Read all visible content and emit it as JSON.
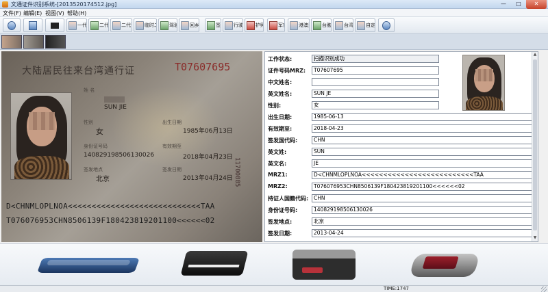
{
  "window": {
    "title": "文通证件识别系统-[2013520174512.jpg]",
    "controls": {
      "minimize": "—",
      "maximize": "□",
      "close": "✕"
    }
  },
  "menu": [
    "文件(F)",
    "编辑(E)",
    "视图(V)",
    "帮助(H)"
  ],
  "toolbar": {
    "items": [
      {
        "label": "",
        "icon": "gear-icon"
      },
      {
        "label": "",
        "icon": "camera-icon"
      },
      {
        "label": "",
        "icon": "scanner-icon"
      },
      {
        "label": "一代证",
        "icon": "id-card-icon"
      },
      {
        "label": "二代证",
        "icon": "id-card-icon"
      },
      {
        "label": "二代背面",
        "icon": "id-card-icon"
      },
      {
        "label": "临时二代",
        "icon": "id-card-icon"
      },
      {
        "label": "驾驶证",
        "icon": "id-card-icon"
      },
      {
        "label": "回乡证",
        "icon": "id-card-icon"
      },
      {
        "label": "签证",
        "icon": "id-card-icon"
      },
      {
        "label": "行驶证",
        "icon": "id-card-icon"
      },
      {
        "label": "护照",
        "icon": "passport-icon"
      },
      {
        "label": "军官证",
        "icon": "id-card-icon"
      },
      {
        "label": "港澳通行证",
        "icon": "id-card-icon"
      },
      {
        "label": "台胞证",
        "icon": "id-card-icon"
      },
      {
        "label": "台湾通行证",
        "icon": "id-card-icon"
      },
      {
        "label": "自定义",
        "icon": "id-card-icon"
      },
      {
        "label": "",
        "icon": "help-icon"
      }
    ]
  },
  "card_image": {
    "header": "大陆居民往来台湾通行证",
    "number": "T07607695",
    "name_cn": "",
    "name_en": "SUN JIE",
    "sex": "女",
    "birth": "1985年06月13日",
    "id_number": "140829198506130026",
    "expiry": "2018年04月23日",
    "place": "北京",
    "issue": "2013年04月24日",
    "vertical_number": "11700885",
    "mrz1": "D<CHNMLOPLNOA<<<<<<<<<<<<<<<<<<<<<<<<<<<<TAA",
    "mrz2": "T076076953CHN8506139F180423819201100<<<<<<02",
    "lbl_name": "姓 名",
    "lbl_sex": "性别",
    "lbl_birth": "出生日期",
    "lbl_id": "身份证号码",
    "lbl_expiry": "有效期至",
    "lbl_place": "签发地点",
    "lbl_issue": "签发日期"
  },
  "form": {
    "fields": [
      {
        "label": "工作状态:",
        "value": "扫描识别成功"
      },
      {
        "label": "证件号码MRZ:",
        "value": "T07607695"
      },
      {
        "label": "中文姓名:",
        "value": ""
      },
      {
        "label": "英文姓名:",
        "value": "SUN JE"
      },
      {
        "label": "性别:",
        "value": "女"
      },
      {
        "label": "出生日期:",
        "value": "1985-06-13"
      },
      {
        "label": "有效期至:",
        "value": "2018-04-23"
      },
      {
        "label": "签发国代码:",
        "value": "CHN"
      },
      {
        "label": "英文姓:",
        "value": "SUN"
      },
      {
        "label": "英文名:",
        "value": "JE"
      },
      {
        "label": "MRZ1:",
        "value": "D<CHNMLOPLNOA<<<<<<<<<<<<<<<<<<<<<<<<<<TAA"
      },
      {
        "label": "MRZ2:",
        "value": "T076076953CHN8506139F180423819201100<<<<<<02"
      },
      {
        "label": "持证人国籍代码:",
        "value": "CHN"
      },
      {
        "label": "身份证号码:",
        "value": "140829198506130026"
      },
      {
        "label": "签发地点:",
        "value": "北京"
      },
      {
        "label": "签发日期:",
        "value": "2013-04-24"
      }
    ]
  },
  "status": {
    "time": "TIME:1747"
  }
}
